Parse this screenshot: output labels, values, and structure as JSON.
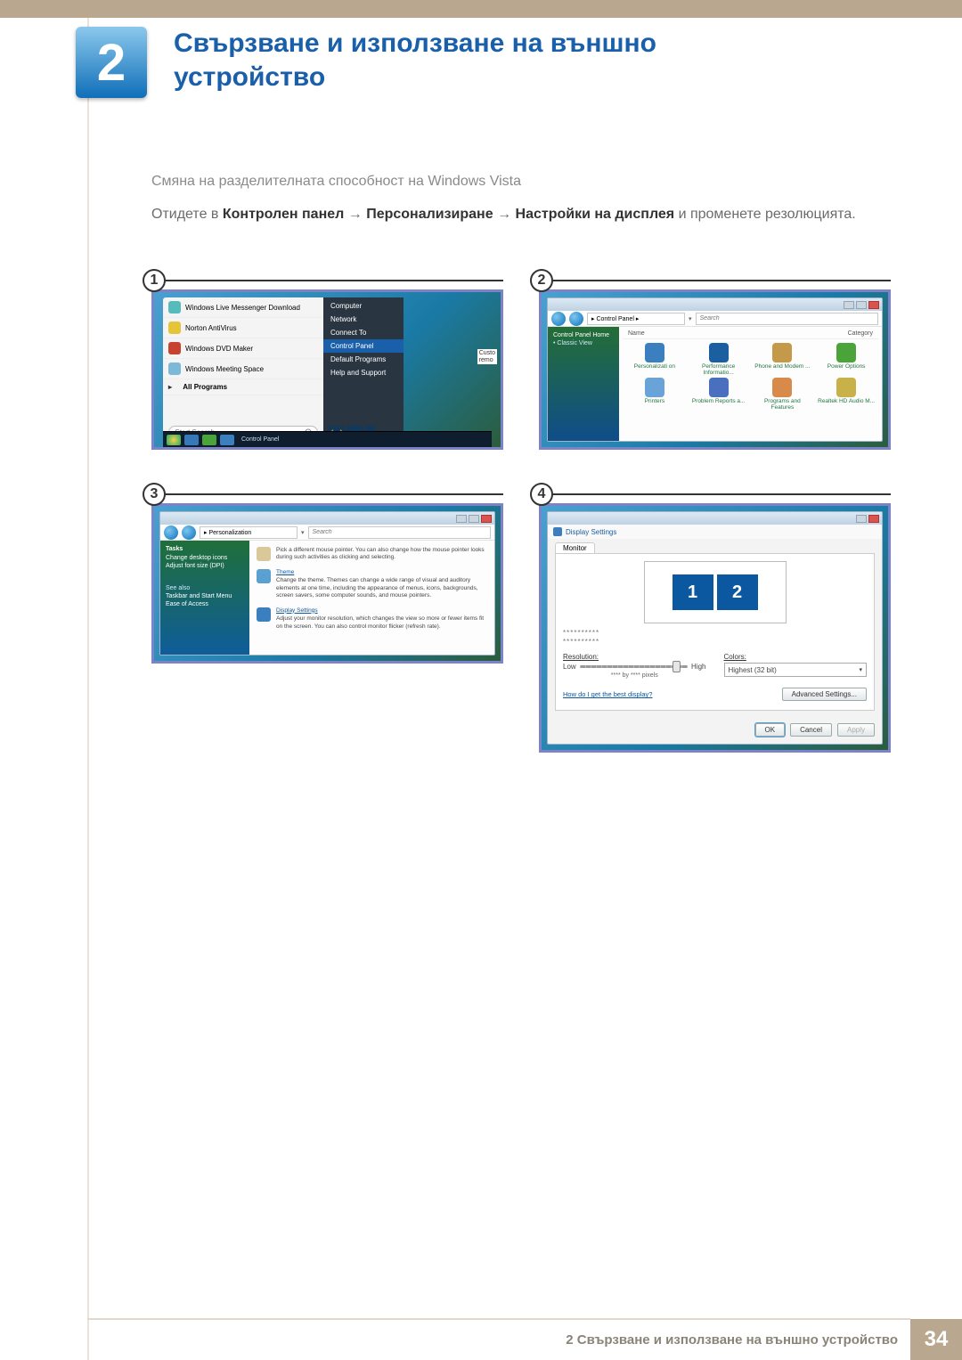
{
  "chapter": {
    "number": "2",
    "title": "Свързване и използване на външно устройство"
  },
  "section": {
    "subtitle": "Смяна на разделителната способност на Windows Vista"
  },
  "instruction": {
    "prefix": "Отидете в ",
    "b1": "Контролен панел",
    "arrow": " → ",
    "b2": "Персонализиране",
    "b3": "Настройки на дисплея",
    "suffix": " и променете резолюцията."
  },
  "steps": {
    "s1": "1",
    "s2": "2",
    "s3": "3",
    "s4": "4"
  },
  "fig1": {
    "left_items": [
      "Windows Live Messenger Download",
      "Norton AntiVirus",
      "Windows DVD Maker",
      "Windows Meeting Space"
    ],
    "all_programs": "All Programs",
    "search_placeholder": "Start Search",
    "right_items": [
      "Computer",
      "Network",
      "Connect To",
      "Control Panel",
      "Default Programs",
      "Help and Support"
    ],
    "right_highlight_index": 3,
    "custo": "Custo",
    "remo": "remo",
    "taskbar_label": "Control Panel"
  },
  "fig2": {
    "path": "▸ Control Panel ▸",
    "search": "Search",
    "side_links": [
      "Control Panel Home",
      "Classic View"
    ],
    "header_left": "Name",
    "header_right": "Category",
    "items": [
      "Personalizati on",
      "Performance Informatio...",
      "Phone and Modem ...",
      "Power Options",
      "Printers",
      "Problem Reports a...",
      "Programs and Features",
      "Realtek HD Audio M..."
    ]
  },
  "fig3": {
    "path": "▸ Personalization",
    "search": "Search",
    "tasks": "Tasks",
    "side_links": [
      "Change desktop icons",
      "Adjust font size (DPI)"
    ],
    "see_also": "See also",
    "see_links": [
      "Taskbar and Start Menu",
      "Ease of Access"
    ],
    "items": [
      {
        "title": "",
        "desc": "Pick a different mouse pointer. You can also change how the mouse pointer looks during such activities as clicking and selecting."
      },
      {
        "title": "Theme",
        "desc": "Change the theme. Themes can change a wide range of visual and auditory elements at one time, including the appearance of menus, icons, backgrounds, screen savers, some computer sounds, and mouse pointers."
      },
      {
        "title": "Display Settings",
        "desc": "Adjust your monitor resolution, which changes the view so more or fewer items fit on the screen. You can also control monitor flicker (refresh rate)."
      }
    ]
  },
  "fig4": {
    "title": "Display Settings",
    "tab": "Monitor",
    "mon1": "1",
    "mon2": "2",
    "dots1": "**********",
    "dots2": "**********",
    "res_label": "Resolution:",
    "low": "Low",
    "high": "High",
    "pixres": "**** by **** pixels",
    "colors_label": "Colors:",
    "colors_val": "Highest (32 bit)",
    "best_link": "How do I get the best display?",
    "adv_btn": "Advanced Settings...",
    "ok": "OK",
    "cancel": "Cancel",
    "apply": "Apply"
  },
  "footer": {
    "text": "2 Свързване и използване на външно устройство",
    "page": "34"
  }
}
